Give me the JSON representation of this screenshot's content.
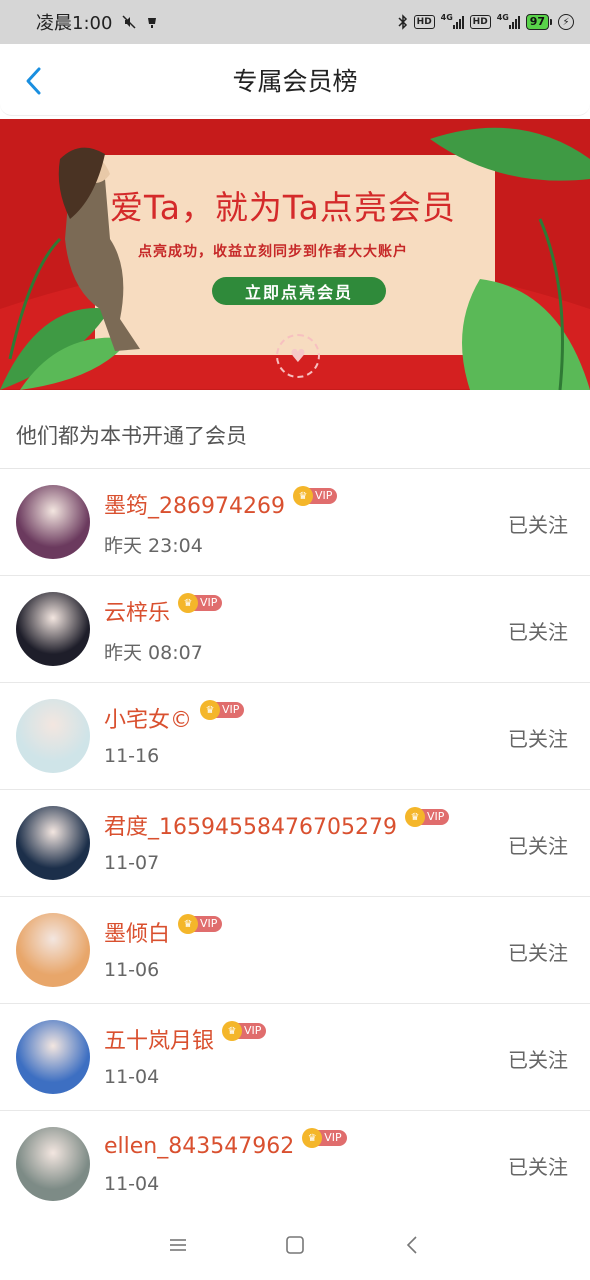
{
  "status_bar": {
    "time": "凌晨1:00",
    "battery": "97",
    "network": "4G"
  },
  "header": {
    "title": "专属会员榜"
  },
  "banner": {
    "title": "爱Ta，就为Ta点亮会员",
    "subtitle": "点亮成功，收益立刻同步到作者大大账户",
    "cta_label": "立即点亮会员"
  },
  "section": {
    "heading": "他们都为本书开通了会员"
  },
  "vip_label": "VIP",
  "members": [
    {
      "name": "墨筠_286974269",
      "time": "昨天 23:04",
      "status": "已关注",
      "avatar_color": "#6b3a5e"
    },
    {
      "name": "云梓乐",
      "time": "昨天 08:07",
      "status": "已关注",
      "avatar_color": "#1e1e2a"
    },
    {
      "name": "小宅女©",
      "time": "11-16",
      "status": "已关注",
      "avatar_color": "#cfe4e8"
    },
    {
      "name": "君度_16594558476705279",
      "time": "11-07",
      "status": "已关注",
      "avatar_color": "#1c2f4a"
    },
    {
      "name": "墨倾白",
      "time": "11-06",
      "status": "已关注",
      "avatar_color": "#e8a66a"
    },
    {
      "name": "五十岚月银",
      "time": "11-04",
      "status": "已关注",
      "avatar_color": "#3d6fc2"
    },
    {
      "name": "ellen_843547962",
      "time": "11-04",
      "status": "已关注",
      "avatar_color": "#7d8b86"
    }
  ],
  "colors": {
    "accent_blue": "#1a8fe0",
    "name_red": "#d9502f",
    "banner_red": "#c61b1b",
    "vip_gold": "#f4b62a"
  }
}
